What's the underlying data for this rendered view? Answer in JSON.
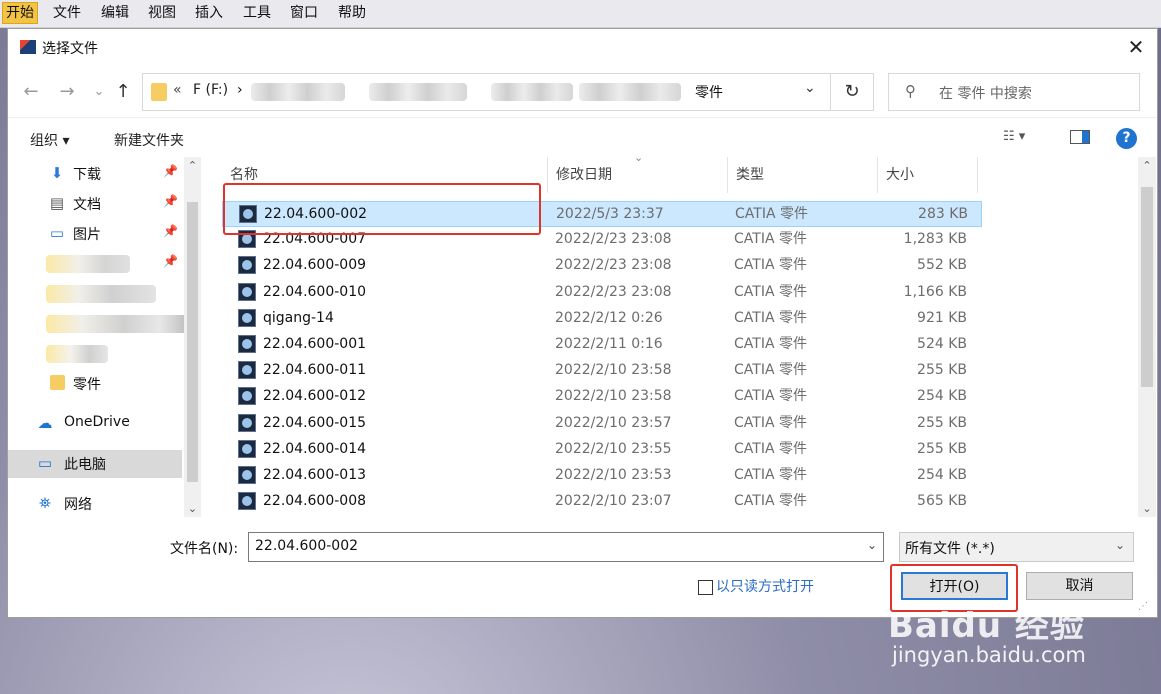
{
  "app_menu": {
    "items": [
      {
        "label": "开始",
        "active": true
      },
      {
        "label": "文件"
      },
      {
        "label": "编辑"
      },
      {
        "label": "视图"
      },
      {
        "label": "插入"
      },
      {
        "label": "工具"
      },
      {
        "label": "窗口"
      },
      {
        "label": "帮助"
      }
    ]
  },
  "dialog": {
    "title": "选择文件",
    "close_icon": "close-icon"
  },
  "navigation": {
    "back_icon": "←",
    "forward_icon": "→",
    "recent_icon": "⌄",
    "up_icon": "↑",
    "address": {
      "prefix": "«",
      "drive": "F (F:)",
      "separator": "›",
      "current_folder": "零件"
    },
    "refresh_icon": "↻",
    "search_placeholder": "在 零件 中搜索"
  },
  "toolbar": {
    "organize": "组织 ▾",
    "new_folder": "新建文件夹",
    "view_icon": "view-options-icon",
    "preview_icon": "preview-pane-icon",
    "help": "?"
  },
  "nav_pane": {
    "items": [
      {
        "label": "下载",
        "icon": "download-icon",
        "pinned": true
      },
      {
        "label": "文档",
        "icon": "document-icon",
        "pinned": true
      },
      {
        "label": "图片",
        "icon": "picture-icon",
        "pinned": true
      },
      {
        "label": "",
        "icon": "folder-icon",
        "pinned": true,
        "blurred": true
      },
      {
        "label": "",
        "icon": "folder-icon",
        "blurred": true
      },
      {
        "label": "",
        "icon": "folder-icon",
        "blurred": true
      },
      {
        "label": "",
        "icon": "folder-icon",
        "blurred": true
      },
      {
        "label": "零件",
        "icon": "folder-icon"
      },
      {
        "label": "OneDrive",
        "icon": "cloud-icon"
      },
      {
        "label": "此电脑",
        "icon": "computer-icon",
        "selected": true
      },
      {
        "label": "网络",
        "icon": "network-icon"
      }
    ]
  },
  "file_list": {
    "columns": [
      "名称",
      "修改日期",
      "类型",
      "大小"
    ],
    "rows": [
      {
        "name": "22.04.600-002",
        "date": "2022/5/3 23:37",
        "type": "CATIA 零件",
        "size": "283 KB",
        "selected": true
      },
      {
        "name": "22.04.600-007",
        "date": "2022/2/23 23:08",
        "type": "CATIA 零件",
        "size": "1,283 KB"
      },
      {
        "name": "22.04.600-009",
        "date": "2022/2/23 23:08",
        "type": "CATIA 零件",
        "size": "552 KB"
      },
      {
        "name": "22.04.600-010",
        "date": "2022/2/23 23:08",
        "type": "CATIA 零件",
        "size": "1,166 KB"
      },
      {
        "name": "qigang-14",
        "date": "2022/2/12 0:26",
        "type": "CATIA 零件",
        "size": "921 KB"
      },
      {
        "name": "22.04.600-001",
        "date": "2022/2/11 0:16",
        "type": "CATIA 零件",
        "size": "524 KB"
      },
      {
        "name": "22.04.600-011",
        "date": "2022/2/10 23:58",
        "type": "CATIA 零件",
        "size": "255 KB"
      },
      {
        "name": "22.04.600-012",
        "date": "2022/2/10 23:58",
        "type": "CATIA 零件",
        "size": "254 KB"
      },
      {
        "name": "22.04.600-015",
        "date": "2022/2/10 23:57",
        "type": "CATIA 零件",
        "size": "255 KB"
      },
      {
        "name": "22.04.600-014",
        "date": "2022/2/10 23:55",
        "type": "CATIA 零件",
        "size": "255 KB"
      },
      {
        "name": "22.04.600-013",
        "date": "2022/2/10 23:53",
        "type": "CATIA 零件",
        "size": "254 KB"
      },
      {
        "name": "22.04.600-008",
        "date": "2022/2/10 23:07",
        "type": "CATIA 零件",
        "size": "565 KB"
      }
    ]
  },
  "bottom": {
    "filename_label": "文件名(N):",
    "filename_value": "22.04.600-002",
    "filter_value": "所有文件 (*.*)",
    "readonly_label": "以只读方式打开",
    "open_label": "打开(O)",
    "cancel_label": "取消"
  },
  "watermark": {
    "brand": "Baidu 经验",
    "url": "jingyan.baidu.com"
  },
  "colors": {
    "selection": "#cce8ff",
    "highlight_box": "#e0332b",
    "accent": "#1f74d0"
  }
}
